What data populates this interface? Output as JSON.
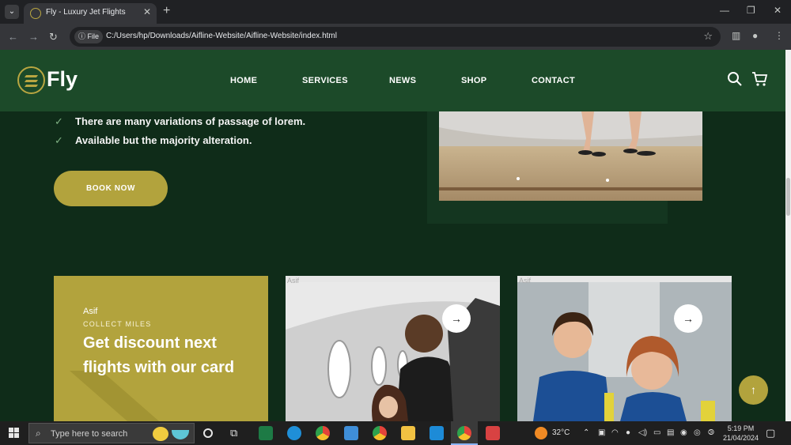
{
  "browser": {
    "tab_title": "Fly - Luxury Jet Flights",
    "tab_close": "✕",
    "new_tab": "+",
    "file_chip": "File",
    "url": "C:/Users/hp/Downloads/Aifline-Website/Aifline-Website/index.html"
  },
  "site": {
    "logo_text": "Fly",
    "nav": [
      "HOME",
      "SERVICES",
      "NEWS",
      "SHOP",
      "CONTACT"
    ],
    "accent": "#b2a33d",
    "header_bg": "#1c4a29",
    "page_bg": "#0f2c19"
  },
  "features": [
    "There are many variations of passage of lorem.",
    "Available but the majority alteration."
  ],
  "book_button": "BOOK NOW",
  "promo": {
    "name": "Asif",
    "tag": "COLLECT MILES",
    "headline": "Get discount next flights with our card"
  },
  "cards": [
    {
      "label": "Asif",
      "arrow": "→"
    },
    {
      "label": "Asif",
      "arrow": "→"
    }
  ],
  "scroll_top": "↑",
  "taskbar": {
    "search_placeholder": "Type here to search",
    "weather": "32°C",
    "time": "5:19 PM",
    "date": "21/04/2024"
  }
}
